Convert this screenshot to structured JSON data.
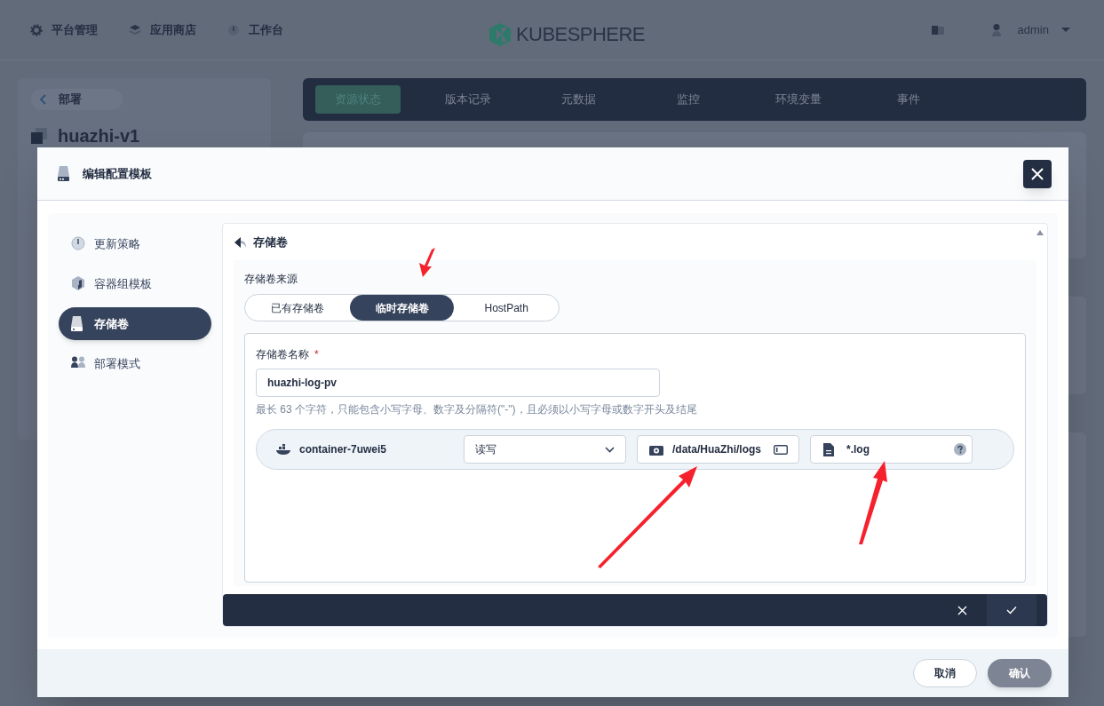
{
  "top_nav": {
    "items": [
      {
        "label": "平台管理"
      },
      {
        "label": "应用商店"
      },
      {
        "label": "工作台"
      }
    ]
  },
  "logo": {
    "text": "KUBESPHERE"
  },
  "user": {
    "name": "admin"
  },
  "background": {
    "back_button": "部署",
    "title": "huazhi-v1",
    "tabs": [
      {
        "label": "资源状态",
        "selected": true
      },
      {
        "label": "版本记录",
        "selected": false
      },
      {
        "label": "元数据",
        "selected": false
      },
      {
        "label": "监控",
        "selected": false
      },
      {
        "label": "环境变量",
        "selected": false
      },
      {
        "label": "事件",
        "selected": false
      }
    ]
  },
  "dialog": {
    "title": "编辑配置模板",
    "nav": [
      {
        "label": "更新策略",
        "selected": false
      },
      {
        "label": "容器组模板",
        "selected": false
      },
      {
        "label": "存储卷",
        "selected": true
      },
      {
        "label": "部署模式",
        "selected": false
      }
    ],
    "section_title": "存储卷",
    "source_label": "存储卷来源",
    "source_options": [
      {
        "label": "已有存储卷",
        "selected": false
      },
      {
        "label": "临时存储卷",
        "selected": true
      },
      {
        "label": "HostPath",
        "selected": false
      }
    ],
    "name_label": "存储卷名称",
    "required_mark": "*",
    "name_value": "huazhi-log-pv",
    "hint": "最长 63 个字符，只能包含小写字母、数字及分隔符(\"-\")，且必须以小写字母或数字开头及结尾",
    "mount": {
      "container": "container-7uwei5",
      "access_mode": "读写",
      "mount_path": "/data/HuaZhi/logs",
      "log_path": "*.log"
    },
    "footer": {
      "cancel": "取消",
      "confirm": "确认"
    }
  }
}
